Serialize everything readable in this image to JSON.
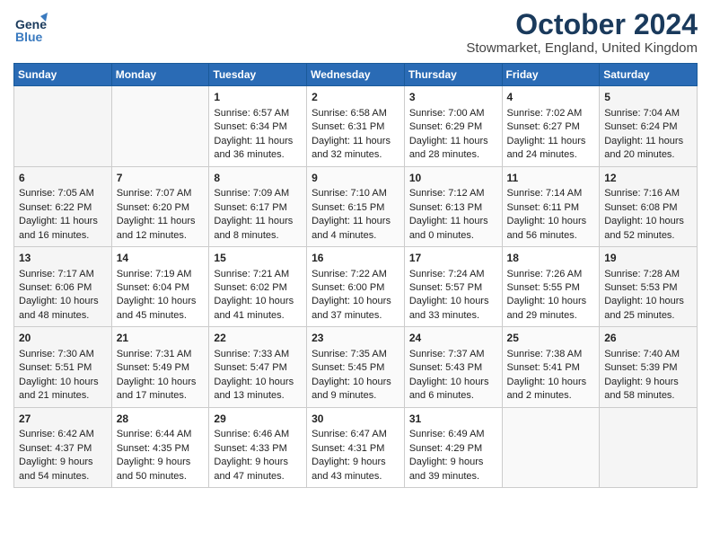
{
  "header": {
    "logo": {
      "line1": "General",
      "line2": "Blue"
    },
    "title": "October 2024",
    "location": "Stowmarket, England, United Kingdom"
  },
  "weekdays": [
    "Sunday",
    "Monday",
    "Tuesday",
    "Wednesday",
    "Thursday",
    "Friday",
    "Saturday"
  ],
  "weeks": [
    [
      {
        "day": "",
        "sunrise": "",
        "sunset": "",
        "daylight": ""
      },
      {
        "day": "",
        "sunrise": "",
        "sunset": "",
        "daylight": ""
      },
      {
        "day": "1",
        "sunrise": "Sunrise: 6:57 AM",
        "sunset": "Sunset: 6:34 PM",
        "daylight": "Daylight: 11 hours and 36 minutes."
      },
      {
        "day": "2",
        "sunrise": "Sunrise: 6:58 AM",
        "sunset": "Sunset: 6:31 PM",
        "daylight": "Daylight: 11 hours and 32 minutes."
      },
      {
        "day": "3",
        "sunrise": "Sunrise: 7:00 AM",
        "sunset": "Sunset: 6:29 PM",
        "daylight": "Daylight: 11 hours and 28 minutes."
      },
      {
        "day": "4",
        "sunrise": "Sunrise: 7:02 AM",
        "sunset": "Sunset: 6:27 PM",
        "daylight": "Daylight: 11 hours and 24 minutes."
      },
      {
        "day": "5",
        "sunrise": "Sunrise: 7:04 AM",
        "sunset": "Sunset: 6:24 PM",
        "daylight": "Daylight: 11 hours and 20 minutes."
      }
    ],
    [
      {
        "day": "6",
        "sunrise": "Sunrise: 7:05 AM",
        "sunset": "Sunset: 6:22 PM",
        "daylight": "Daylight: 11 hours and 16 minutes."
      },
      {
        "day": "7",
        "sunrise": "Sunrise: 7:07 AM",
        "sunset": "Sunset: 6:20 PM",
        "daylight": "Daylight: 11 hours and 12 minutes."
      },
      {
        "day": "8",
        "sunrise": "Sunrise: 7:09 AM",
        "sunset": "Sunset: 6:17 PM",
        "daylight": "Daylight: 11 hours and 8 minutes."
      },
      {
        "day": "9",
        "sunrise": "Sunrise: 7:10 AM",
        "sunset": "Sunset: 6:15 PM",
        "daylight": "Daylight: 11 hours and 4 minutes."
      },
      {
        "day": "10",
        "sunrise": "Sunrise: 7:12 AM",
        "sunset": "Sunset: 6:13 PM",
        "daylight": "Daylight: 11 hours and 0 minutes."
      },
      {
        "day": "11",
        "sunrise": "Sunrise: 7:14 AM",
        "sunset": "Sunset: 6:11 PM",
        "daylight": "Daylight: 10 hours and 56 minutes."
      },
      {
        "day": "12",
        "sunrise": "Sunrise: 7:16 AM",
        "sunset": "Sunset: 6:08 PM",
        "daylight": "Daylight: 10 hours and 52 minutes."
      }
    ],
    [
      {
        "day": "13",
        "sunrise": "Sunrise: 7:17 AM",
        "sunset": "Sunset: 6:06 PM",
        "daylight": "Daylight: 10 hours and 48 minutes."
      },
      {
        "day": "14",
        "sunrise": "Sunrise: 7:19 AM",
        "sunset": "Sunset: 6:04 PM",
        "daylight": "Daylight: 10 hours and 45 minutes."
      },
      {
        "day": "15",
        "sunrise": "Sunrise: 7:21 AM",
        "sunset": "Sunset: 6:02 PM",
        "daylight": "Daylight: 10 hours and 41 minutes."
      },
      {
        "day": "16",
        "sunrise": "Sunrise: 7:22 AM",
        "sunset": "Sunset: 6:00 PM",
        "daylight": "Daylight: 10 hours and 37 minutes."
      },
      {
        "day": "17",
        "sunrise": "Sunrise: 7:24 AM",
        "sunset": "Sunset: 5:57 PM",
        "daylight": "Daylight: 10 hours and 33 minutes."
      },
      {
        "day": "18",
        "sunrise": "Sunrise: 7:26 AM",
        "sunset": "Sunset: 5:55 PM",
        "daylight": "Daylight: 10 hours and 29 minutes."
      },
      {
        "day": "19",
        "sunrise": "Sunrise: 7:28 AM",
        "sunset": "Sunset: 5:53 PM",
        "daylight": "Daylight: 10 hours and 25 minutes."
      }
    ],
    [
      {
        "day": "20",
        "sunrise": "Sunrise: 7:30 AM",
        "sunset": "Sunset: 5:51 PM",
        "daylight": "Daylight: 10 hours and 21 minutes."
      },
      {
        "day": "21",
        "sunrise": "Sunrise: 7:31 AM",
        "sunset": "Sunset: 5:49 PM",
        "daylight": "Daylight: 10 hours and 17 minutes."
      },
      {
        "day": "22",
        "sunrise": "Sunrise: 7:33 AM",
        "sunset": "Sunset: 5:47 PM",
        "daylight": "Daylight: 10 hours and 13 minutes."
      },
      {
        "day": "23",
        "sunrise": "Sunrise: 7:35 AM",
        "sunset": "Sunset: 5:45 PM",
        "daylight": "Daylight: 10 hours and 9 minutes."
      },
      {
        "day": "24",
        "sunrise": "Sunrise: 7:37 AM",
        "sunset": "Sunset: 5:43 PM",
        "daylight": "Daylight: 10 hours and 6 minutes."
      },
      {
        "day": "25",
        "sunrise": "Sunrise: 7:38 AM",
        "sunset": "Sunset: 5:41 PM",
        "daylight": "Daylight: 10 hours and 2 minutes."
      },
      {
        "day": "26",
        "sunrise": "Sunrise: 7:40 AM",
        "sunset": "Sunset: 5:39 PM",
        "daylight": "Daylight: 9 hours and 58 minutes."
      }
    ],
    [
      {
        "day": "27",
        "sunrise": "Sunrise: 6:42 AM",
        "sunset": "Sunset: 4:37 PM",
        "daylight": "Daylight: 9 hours and 54 minutes."
      },
      {
        "day": "28",
        "sunrise": "Sunrise: 6:44 AM",
        "sunset": "Sunset: 4:35 PM",
        "daylight": "Daylight: 9 hours and 50 minutes."
      },
      {
        "day": "29",
        "sunrise": "Sunrise: 6:46 AM",
        "sunset": "Sunset: 4:33 PM",
        "daylight": "Daylight: 9 hours and 47 minutes."
      },
      {
        "day": "30",
        "sunrise": "Sunrise: 6:47 AM",
        "sunset": "Sunset: 4:31 PM",
        "daylight": "Daylight: 9 hours and 43 minutes."
      },
      {
        "day": "31",
        "sunrise": "Sunrise: 6:49 AM",
        "sunset": "Sunset: 4:29 PM",
        "daylight": "Daylight: 9 hours and 39 minutes."
      },
      {
        "day": "",
        "sunrise": "",
        "sunset": "",
        "daylight": ""
      },
      {
        "day": "",
        "sunrise": "",
        "sunset": "",
        "daylight": ""
      }
    ]
  ]
}
